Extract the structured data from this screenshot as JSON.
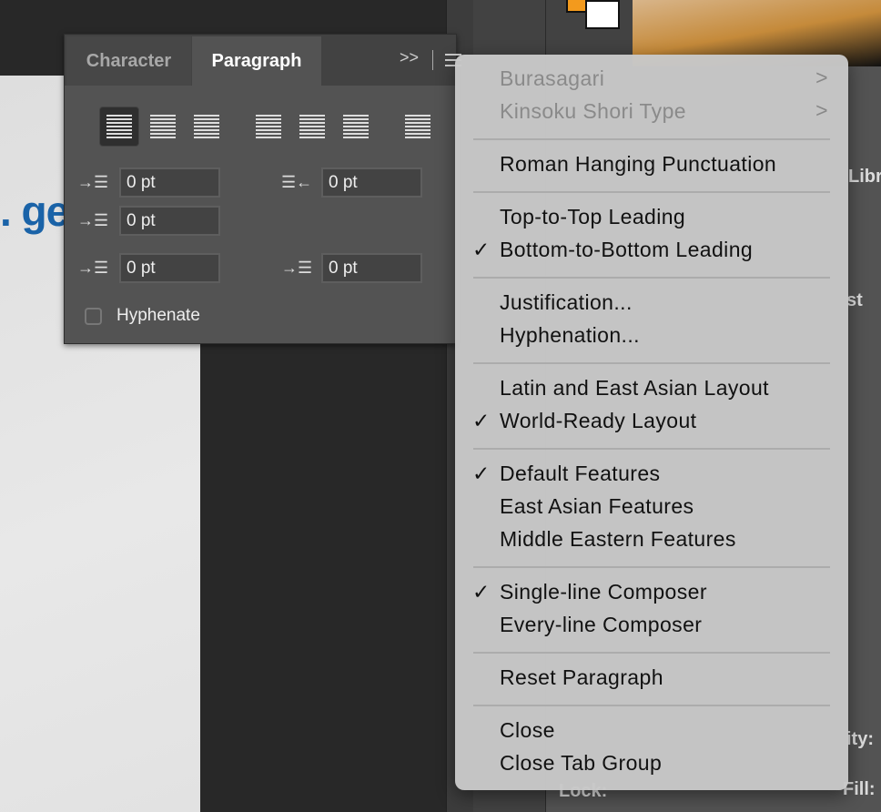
{
  "background": {
    "canvas_fragment": ". ge",
    "right_fragments": [
      "Libr",
      "st",
      "ity:",
      "Fill:",
      "Lock:"
    ]
  },
  "colors": {
    "foreground_swatch": "#f39a1d",
    "background_swatch": "#ffffff"
  },
  "panel": {
    "tabs": [
      {
        "label": "Character",
        "active": false
      },
      {
        "label": "Paragraph",
        "active": true
      }
    ],
    "expand_label": ">>",
    "alignment_buttons": [
      "align-left",
      "align-center",
      "align-right",
      "justify-last-left",
      "justify-last-center",
      "justify-last-right",
      "justify-all"
    ],
    "selected_alignment": "align-left",
    "fields": {
      "indent_left": "0 pt",
      "indent_right": "0 pt",
      "indent_first_line": "0 pt",
      "space_before": "0 pt",
      "space_after": "0 pt"
    },
    "hyphenate": {
      "label": "Hyphenate",
      "checked": false
    }
  },
  "menu": {
    "groups": [
      [
        {
          "label": "Burasagari",
          "disabled": true,
          "submenu": ">"
        },
        {
          "label": "Kinsoku Shori Type",
          "disabled": true,
          "submenu": ">"
        }
      ],
      [
        {
          "label": "Roman Hanging Punctuation"
        }
      ],
      [
        {
          "label": "Top-to-Top Leading"
        },
        {
          "label": "Bottom-to-Bottom Leading",
          "checked": true
        }
      ],
      [
        {
          "label": "Justification..."
        },
        {
          "label": "Hyphenation..."
        }
      ],
      [
        {
          "label": "Latin and East Asian Layout"
        },
        {
          "label": "World-Ready Layout",
          "checked": true
        }
      ],
      [
        {
          "label": "Default Features",
          "checked": true
        },
        {
          "label": "East Asian Features"
        },
        {
          "label": "Middle Eastern Features"
        }
      ],
      [
        {
          "label": "Single-line Composer",
          "checked": true
        },
        {
          "label": "Every-line Composer"
        }
      ],
      [
        {
          "label": "Reset Paragraph"
        }
      ],
      [
        {
          "label": "Close"
        },
        {
          "label": "Close Tab Group"
        }
      ]
    ],
    "check_glyph": "✓"
  }
}
